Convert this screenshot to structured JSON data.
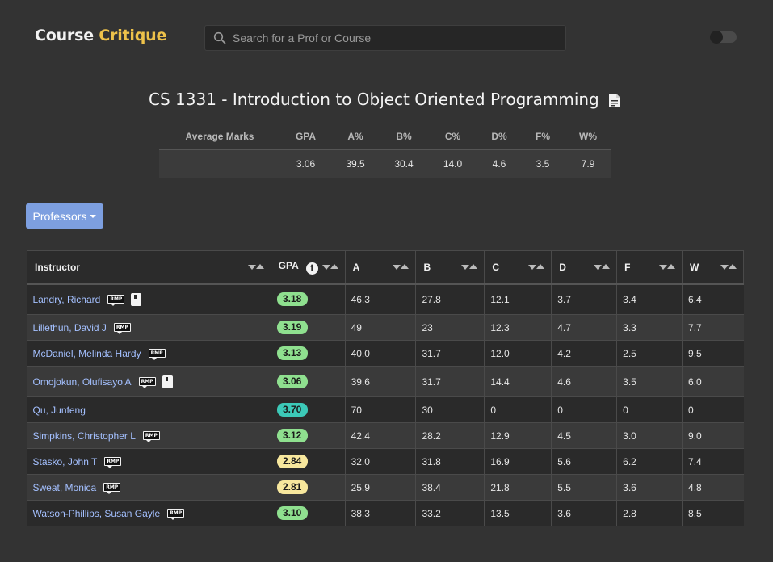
{
  "header": {
    "logo_main": "Course",
    "logo_accent": "Critique",
    "search_placeholder": "Search for a Prof or Course"
  },
  "course": {
    "title": "CS 1331 - Introduction to Object Oriented Programming"
  },
  "averages": {
    "columns": [
      "Average Marks",
      "GPA",
      "A%",
      "B%",
      "C%",
      "D%",
      "F%",
      "W%"
    ],
    "values": [
      "",
      "3.06",
      "39.5",
      "30.4",
      "14.0",
      "4.6",
      "3.5",
      "7.9"
    ]
  },
  "professors_button": "Professors",
  "table": {
    "columns": [
      "Instructor",
      "GPA",
      "A",
      "B",
      "C",
      "D",
      "F",
      "W"
    ],
    "info_glyph": "i",
    "rmp_label": "RMP",
    "rows": [
      {
        "name": "Landry, Richard",
        "book": true,
        "gpa": "3.18",
        "gpa_color": "#8fe08f",
        "A": "46.3",
        "B": "27.8",
        "C": "12.1",
        "D": "3.7",
        "F": "3.4",
        "W": "6.4"
      },
      {
        "name": "Lillethun, David J",
        "book": false,
        "gpa": "3.19",
        "gpa_color": "#8fe08f",
        "A": "49",
        "B": "23",
        "C": "12.3",
        "D": "4.7",
        "F": "3.3",
        "W": "7.7"
      },
      {
        "name": "McDaniel, Melinda Hardy",
        "book": false,
        "gpa": "3.13",
        "gpa_color": "#8fe08f",
        "A": "40.0",
        "B": "31.7",
        "C": "12.0",
        "D": "4.2",
        "F": "2.5",
        "W": "9.5"
      },
      {
        "name": "Omojokun, Olufisayo A",
        "book": true,
        "gpa": "3.06",
        "gpa_color": "#8fe08f",
        "A": "39.6",
        "B": "31.7",
        "C": "14.4",
        "D": "4.6",
        "F": "3.5",
        "W": "6.0"
      },
      {
        "name": "Qu, Junfeng",
        "book": false,
        "rmp": false,
        "gpa": "3.70",
        "gpa_color": "#3cc9b8",
        "A": "70",
        "B": "30",
        "C": "0",
        "D": "0",
        "F": "0",
        "W": "0"
      },
      {
        "name": "Simpkins, Christopher L",
        "book": false,
        "gpa": "3.12",
        "gpa_color": "#8fe08f",
        "A": "42.4",
        "B": "28.2",
        "C": "12.9",
        "D": "4.5",
        "F": "3.0",
        "W": "9.0"
      },
      {
        "name": "Stasko, John T",
        "book": false,
        "gpa": "2.84",
        "gpa_color": "#f7e79d",
        "A": "32.0",
        "B": "31.8",
        "C": "16.9",
        "D": "5.6",
        "F": "6.2",
        "W": "7.4"
      },
      {
        "name": "Sweat, Monica",
        "book": false,
        "gpa": "2.81",
        "gpa_color": "#f7e79d",
        "A": "25.9",
        "B": "38.4",
        "C": "21.8",
        "D": "5.5",
        "F": "3.6",
        "W": "4.8"
      },
      {
        "name": "Watson-Phillips, Susan Gayle",
        "book": false,
        "gpa": "3.10",
        "gpa_color": "#8fe08f",
        "A": "38.3",
        "B": "33.2",
        "C": "13.5",
        "D": "3.6",
        "F": "2.8",
        "W": "8.5"
      }
    ]
  }
}
